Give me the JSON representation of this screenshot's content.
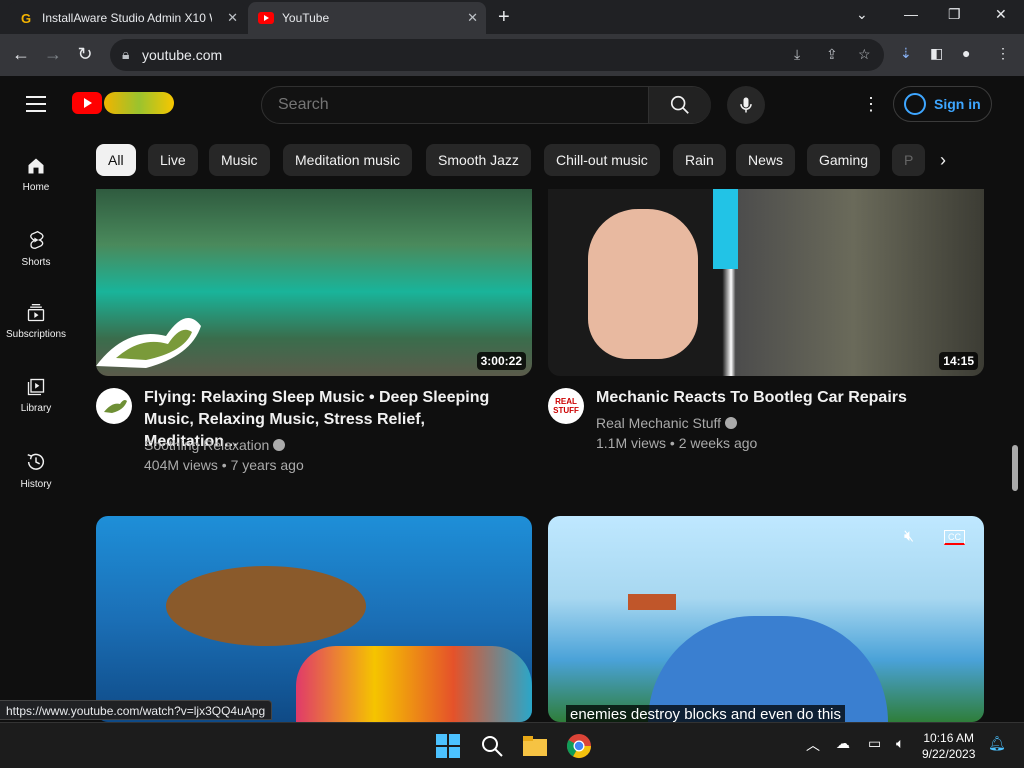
{
  "browser": {
    "tabs": [
      {
        "title": "InstallAware Studio Admin X10 W",
        "favicon": "G"
      },
      {
        "title": "YouTube",
        "favicon": "youtube-icon"
      }
    ],
    "url": "youtube.com",
    "status_url": "https://www.youtube.com/watch?v=ljx3QQ4uApg"
  },
  "youtube": {
    "search_placeholder": "Search",
    "sign_in": "Sign in",
    "chips": [
      "All",
      "Live",
      "Music",
      "Meditation music",
      "Smooth Jazz",
      "Chill-out music",
      "Rain",
      "News",
      "Gaming",
      "P"
    ],
    "selected_chip": "All",
    "guide": [
      {
        "label": "Home",
        "icon": "home-icon"
      },
      {
        "label": "Shorts",
        "icon": "shorts-icon"
      },
      {
        "label": "Subscriptions",
        "icon": "subscriptions-icon"
      },
      {
        "label": "Library",
        "icon": "library-icon"
      },
      {
        "label": "History",
        "icon": "history-icon"
      }
    ],
    "videos": [
      {
        "title_line1": "Flying: Relaxing Sleep Music • Deep Sleeping",
        "title_line2": "Music, Relaxing Music, Stress Relief, Meditation...",
        "channel": "Soothing Relaxation",
        "meta": "404M views • 7 years ago",
        "duration": "3:00:22"
      },
      {
        "title_line1": "Mechanic Reacts To Bootleg Car Repairs",
        "title_line2": "",
        "channel": "Real Mechanic Stuff",
        "meta": "1.1M views • 2 weeks ago",
        "duration": "14:15",
        "avatar_text": "REAL STUFF"
      }
    ],
    "caption": "enemies destroy blocks and even do this",
    "cc_label": "CC"
  },
  "taskbar": {
    "time": "10:16 AM",
    "date": "9/22/2023"
  },
  "colors": {
    "background": "#0f0f0f",
    "chip": "#272727",
    "link_blue": "#3ea6ff",
    "youtube_red": "#ff0000"
  }
}
